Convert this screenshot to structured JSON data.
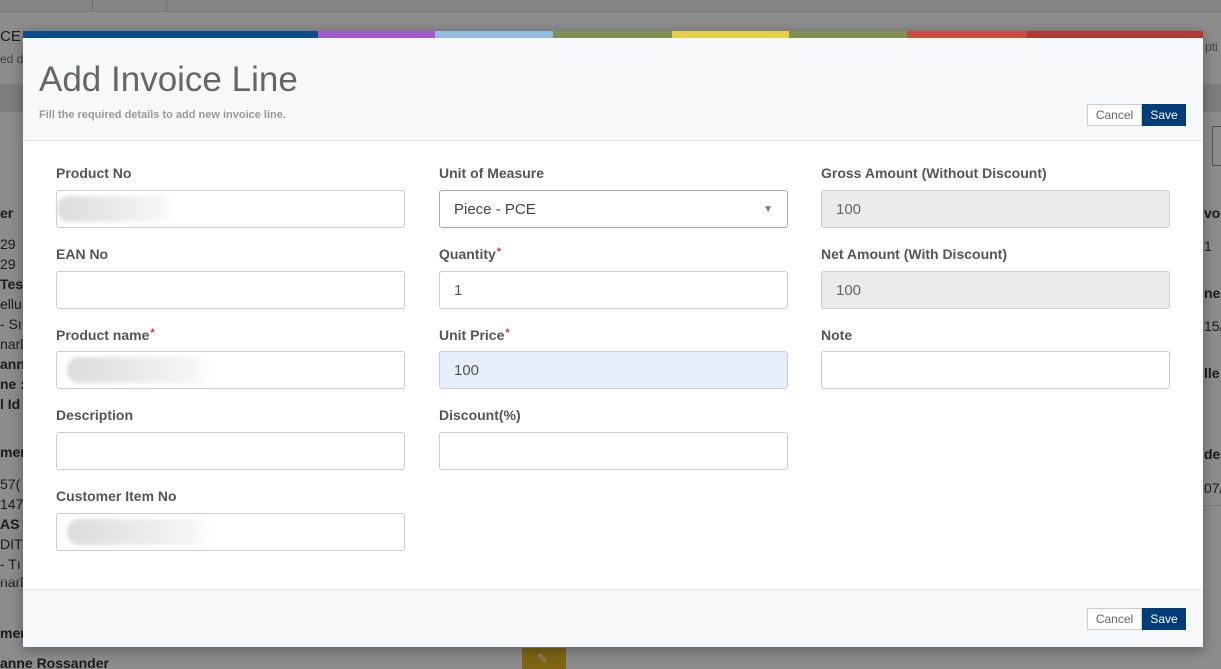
{
  "background": {
    "snippets": [
      "CE",
      "ed d",
      "er",
      "29",
      "29",
      "Tes",
      "ellu",
      "- Sı",
      "narl",
      "ann",
      "ne :",
      "l Id",
      "mer",
      "57(",
      "147",
      "AS",
      "DITC",
      "- Tı",
      "narl",
      "mer",
      "anne Rossander",
      "pti",
      "voi",
      "1",
      "ne l",
      "15/",
      "lle",
      "de",
      "07/"
    ]
  },
  "modal": {
    "color_strip": [
      "#0a4d8c",
      "#a05ccc",
      "#8fbcdf",
      "#7d9152",
      "#e6cf4a",
      "#7d9152",
      "#cc4a42",
      "#b23a32"
    ],
    "title": "Add Invoice Line",
    "subtitle": "Fill the required details to add new invoice line.",
    "buttons": {
      "cancel": "Cancel",
      "save": "Save"
    },
    "fields": {
      "product_no": {
        "label": "Product No",
        "value": ""
      },
      "ean_no": {
        "label": "EAN No",
        "value": ""
      },
      "product_name": {
        "label": "Product name",
        "value": ""
      },
      "description": {
        "label": "Description",
        "value": ""
      },
      "customer_item_no": {
        "label": "Customer Item No",
        "value": ""
      },
      "unit_of_measure": {
        "label": "Unit of Measure",
        "value": "Piece - PCE"
      },
      "quantity": {
        "label": "Quantity",
        "value": "1"
      },
      "unit_price": {
        "label": "Unit Price",
        "value": "100"
      },
      "discount": {
        "label": "Discount(%)",
        "value": ""
      },
      "gross_amount": {
        "label": "Gross Amount (Without Discount)",
        "value": "100"
      },
      "net_amount": {
        "label": "Net Amount (With Discount)",
        "value": "100"
      },
      "note": {
        "label": "Note",
        "value": ""
      }
    },
    "required_marker": "*"
  }
}
